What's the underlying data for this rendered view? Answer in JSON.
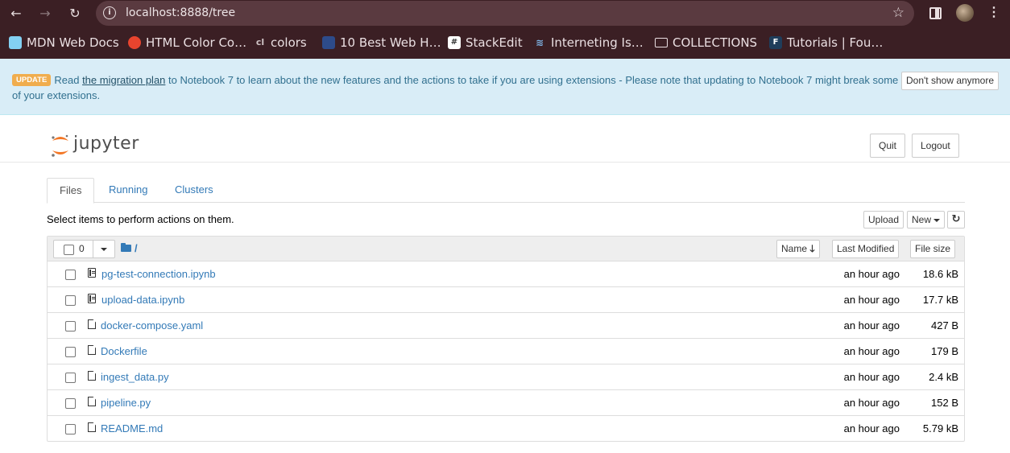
{
  "browser": {
    "url": "localhost:8888/tree",
    "back_icon": "arrow-left-icon",
    "forward_icon": "arrow-right-icon",
    "reload_icon": "reload-icon"
  },
  "bookmarks": [
    {
      "label": "MDN Web Docs",
      "icon": "mdn-icon"
    },
    {
      "label": "HTML Color Co…",
      "icon": "htmlcolor-icon"
    },
    {
      "label": "colors",
      "icon": "colors-icon"
    },
    {
      "label": "10 Best Web H…",
      "icon": "chart-icon"
    },
    {
      "label": "StackEdit",
      "icon": "stackedit-icon"
    },
    {
      "label": "Interneting Is…",
      "icon": "interneting-icon"
    },
    {
      "label": "COLLECTIONS",
      "icon": "folder-icon"
    },
    {
      "label": "Tutorials | Fou…",
      "icon": "foundation-icon"
    }
  ],
  "banner": {
    "badge": "UPDATE",
    "text_before": "Read ",
    "link": "the migration plan",
    "text_after": " to Notebook 7 to learn about the new features and the actions to take if you are using extensions - Please note that updating to Notebook 7 might break some",
    "text_line2": "of your extensions.",
    "dismiss_label": "Don't show anymore"
  },
  "header": {
    "logo_text": "jupyter",
    "quit_label": "Quit",
    "logout_label": "Logout"
  },
  "tabs": [
    {
      "label": "Files",
      "active": true
    },
    {
      "label": "Running",
      "active": false
    },
    {
      "label": "Clusters",
      "active": false
    }
  ],
  "toolbar": {
    "instructions": "Select items to perform actions on them.",
    "upload_label": "Upload",
    "new_label": "New"
  },
  "list_header": {
    "selected_count": "0",
    "breadcrumb": "/",
    "col_name": "Name",
    "col_modified": "Last Modified",
    "col_size": "File size"
  },
  "files": [
    {
      "name": "pg-test-connection.ipynb",
      "type": "notebook",
      "modified": "an hour ago",
      "size": "18.6 kB"
    },
    {
      "name": "upload-data.ipynb",
      "type": "notebook",
      "modified": "an hour ago",
      "size": "17.7 kB"
    },
    {
      "name": "docker-compose.yaml",
      "type": "file",
      "modified": "an hour ago",
      "size": "427 B"
    },
    {
      "name": "Dockerfile",
      "type": "file",
      "modified": "an hour ago",
      "size": "179 B"
    },
    {
      "name": "ingest_data.py",
      "type": "file",
      "modified": "an hour ago",
      "size": "2.4 kB"
    },
    {
      "name": "pipeline.py",
      "type": "file",
      "modified": "an hour ago",
      "size": "152 B"
    },
    {
      "name": "README.md",
      "type": "file",
      "modified": "an hour ago",
      "size": "5.79 kB"
    }
  ],
  "colors": {
    "chrome": "#3b1f24",
    "banner_bg": "#d9edf7",
    "link": "#337ab7",
    "jupyter_orange": "#f37726"
  }
}
